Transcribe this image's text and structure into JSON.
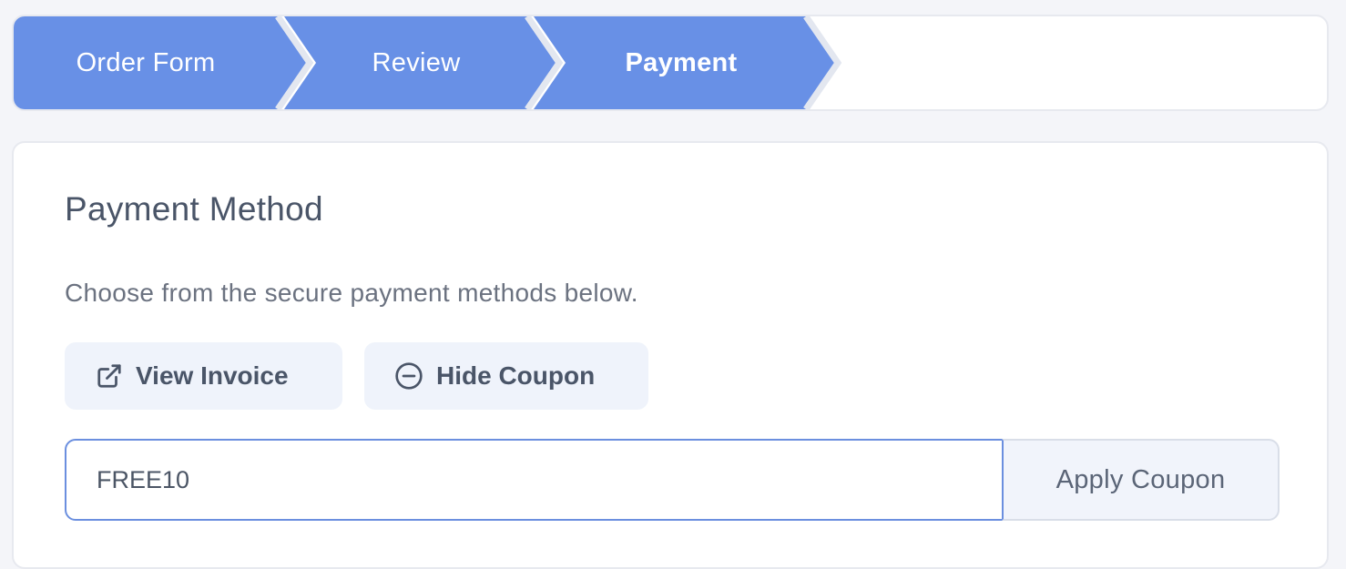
{
  "steps": [
    {
      "label": "Order Form",
      "state": "complete"
    },
    {
      "label": "Review",
      "state": "complete"
    },
    {
      "label": "Payment",
      "state": "active"
    }
  ],
  "payment": {
    "title": "Payment Method",
    "description": "Choose from the secure payment methods below.",
    "view_invoice_label": "View Invoice",
    "view_invoice_icon": "external-link-icon",
    "hide_coupon_label": "Hide Coupon",
    "hide_coupon_icon": "minus-circle-icon"
  },
  "coupon": {
    "value": "FREE10",
    "apply_label": "Apply Coupon"
  },
  "colors": {
    "step_fill": "#6890e6",
    "step_separator": "#e3e7f0",
    "input_focus_border": "#6b8fdf",
    "button_bg": "#eff3fb"
  }
}
